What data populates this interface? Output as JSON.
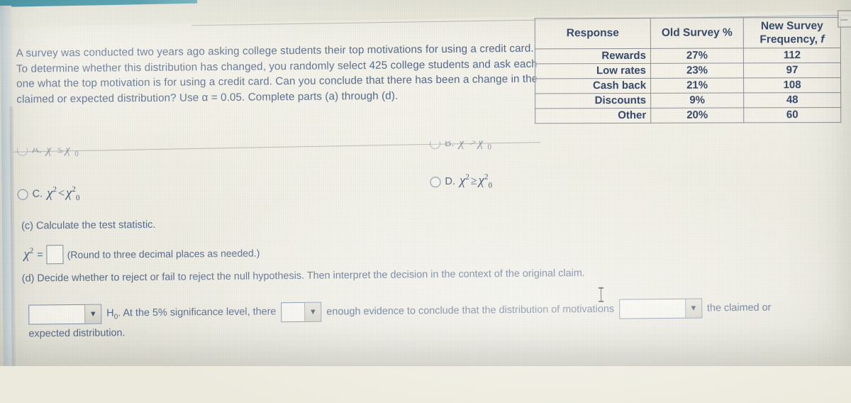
{
  "problem": {
    "statement": "A survey was conducted two years ago asking college students their top motivations for using a credit card. To determine whether this distribution has changed, you randomly select 425 college students and ask each one what the top motivation is for using a credit card. Can you conclude that there has been a change in the claimed or expected distribution? Use α = 0.05. Complete parts (a) through (d)."
  },
  "table": {
    "headers": {
      "response": "Response",
      "old_survey": "Old Survey %",
      "new_survey_line1": "New Survey",
      "new_survey_line2": "Frequency, ",
      "new_survey_italic": "f"
    },
    "rows": [
      {
        "response": "Rewards",
        "old_survey": "27%",
        "new_survey": "112"
      },
      {
        "response": "Low rates",
        "old_survey": "23%",
        "new_survey": "97"
      },
      {
        "response": "Cash back",
        "old_survey": "21%",
        "new_survey": "108"
      },
      {
        "response": "Discounts",
        "old_survey": "9%",
        "new_survey": "48"
      },
      {
        "response": "Other",
        "old_survey": "20%",
        "new_survey": "60"
      }
    ]
  },
  "options": [
    {
      "letter": "A.",
      "chi": "χ",
      "sup": "2",
      "rel": "≤",
      "chi0": "χ",
      "sup0": "2",
      "sub0": "0"
    },
    {
      "letter": "B.",
      "chi": "χ",
      "sup": "2",
      "rel": ">",
      "chi0": "χ",
      "sup0": "2",
      "sub0": "0"
    },
    {
      "letter": "C.",
      "chi": "χ",
      "sup": "2",
      "rel": "<",
      "chi0": "χ",
      "sup0": "2",
      "sub0": "0"
    },
    {
      "letter": "D.",
      "chi": "χ",
      "sup": "2",
      "rel": "≥",
      "chi0": "χ",
      "sup0": "2",
      "sub0": "0"
    }
  ],
  "part_c": {
    "prompt": "(c) Calculate the test statistic.",
    "chi_symbol": "χ",
    "chi_sup": "2",
    "equals": "=",
    "input_value": "",
    "note": "(Round to three decimal places as needed.)"
  },
  "part_d": {
    "prompt": "(d) Decide whether to reject or fail to reject the null hypothesis. Then interpret the decision in the context of the original claim.",
    "select1_value": "",
    "text1": "H",
    "text1_sub": "0",
    "text1_rest": ". At the 5% significance level, there",
    "select2_value": "",
    "text2": "enough evidence to conclude that the distribution of motivations",
    "select3_value": "",
    "text3": "the claimed or",
    "text4": "expected distribution.",
    "dropdown_arrow": "▼"
  }
}
